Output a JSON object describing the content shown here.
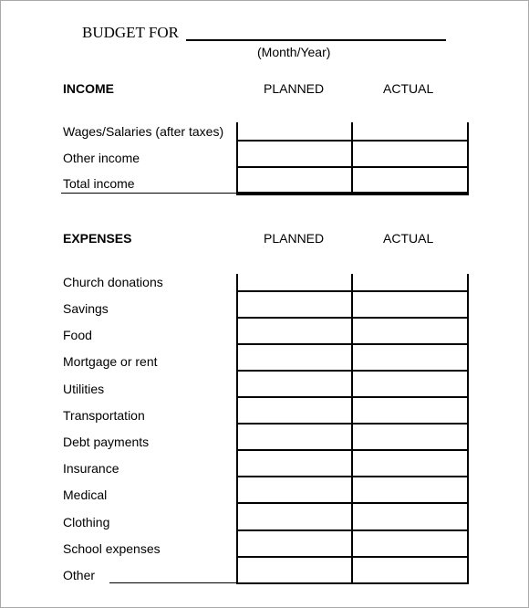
{
  "document": {
    "title": "BUDGET FOR",
    "title_subcaption": "(Month/Year)",
    "month_year_value": ""
  },
  "income": {
    "heading": "INCOME",
    "columns": [
      "PLANNED",
      "ACTUAL"
    ],
    "rows": [
      {
        "label": "Wages/Salaries (after taxes)",
        "planned": "",
        "actual": ""
      },
      {
        "label": "Other income",
        "planned": "",
        "actual": ""
      },
      {
        "label": "Total income",
        "planned": "",
        "actual": ""
      }
    ]
  },
  "expenses": {
    "heading": "EXPENSES",
    "columns": [
      "PLANNED",
      "ACTUAL"
    ],
    "rows": [
      {
        "label": "Church donations",
        "planned": "",
        "actual": ""
      },
      {
        "label": "Savings",
        "planned": "",
        "actual": ""
      },
      {
        "label": "Food",
        "planned": "",
        "actual": ""
      },
      {
        "label": "Mortgage or rent",
        "planned": "",
        "actual": ""
      },
      {
        "label": "Utilities",
        "planned": "",
        "actual": ""
      },
      {
        "label": "Transportation",
        "planned": "",
        "actual": ""
      },
      {
        "label": "Debt payments",
        "planned": "",
        "actual": ""
      },
      {
        "label": "Insurance",
        "planned": "",
        "actual": ""
      },
      {
        "label": "Medical",
        "planned": "",
        "actual": ""
      },
      {
        "label": "Clothing",
        "planned": "",
        "actual": ""
      },
      {
        "label": "School expenses",
        "planned": "",
        "actual": ""
      },
      {
        "label": "Other",
        "planned": "",
        "actual": "",
        "has_write_in_line": true
      }
    ]
  }
}
